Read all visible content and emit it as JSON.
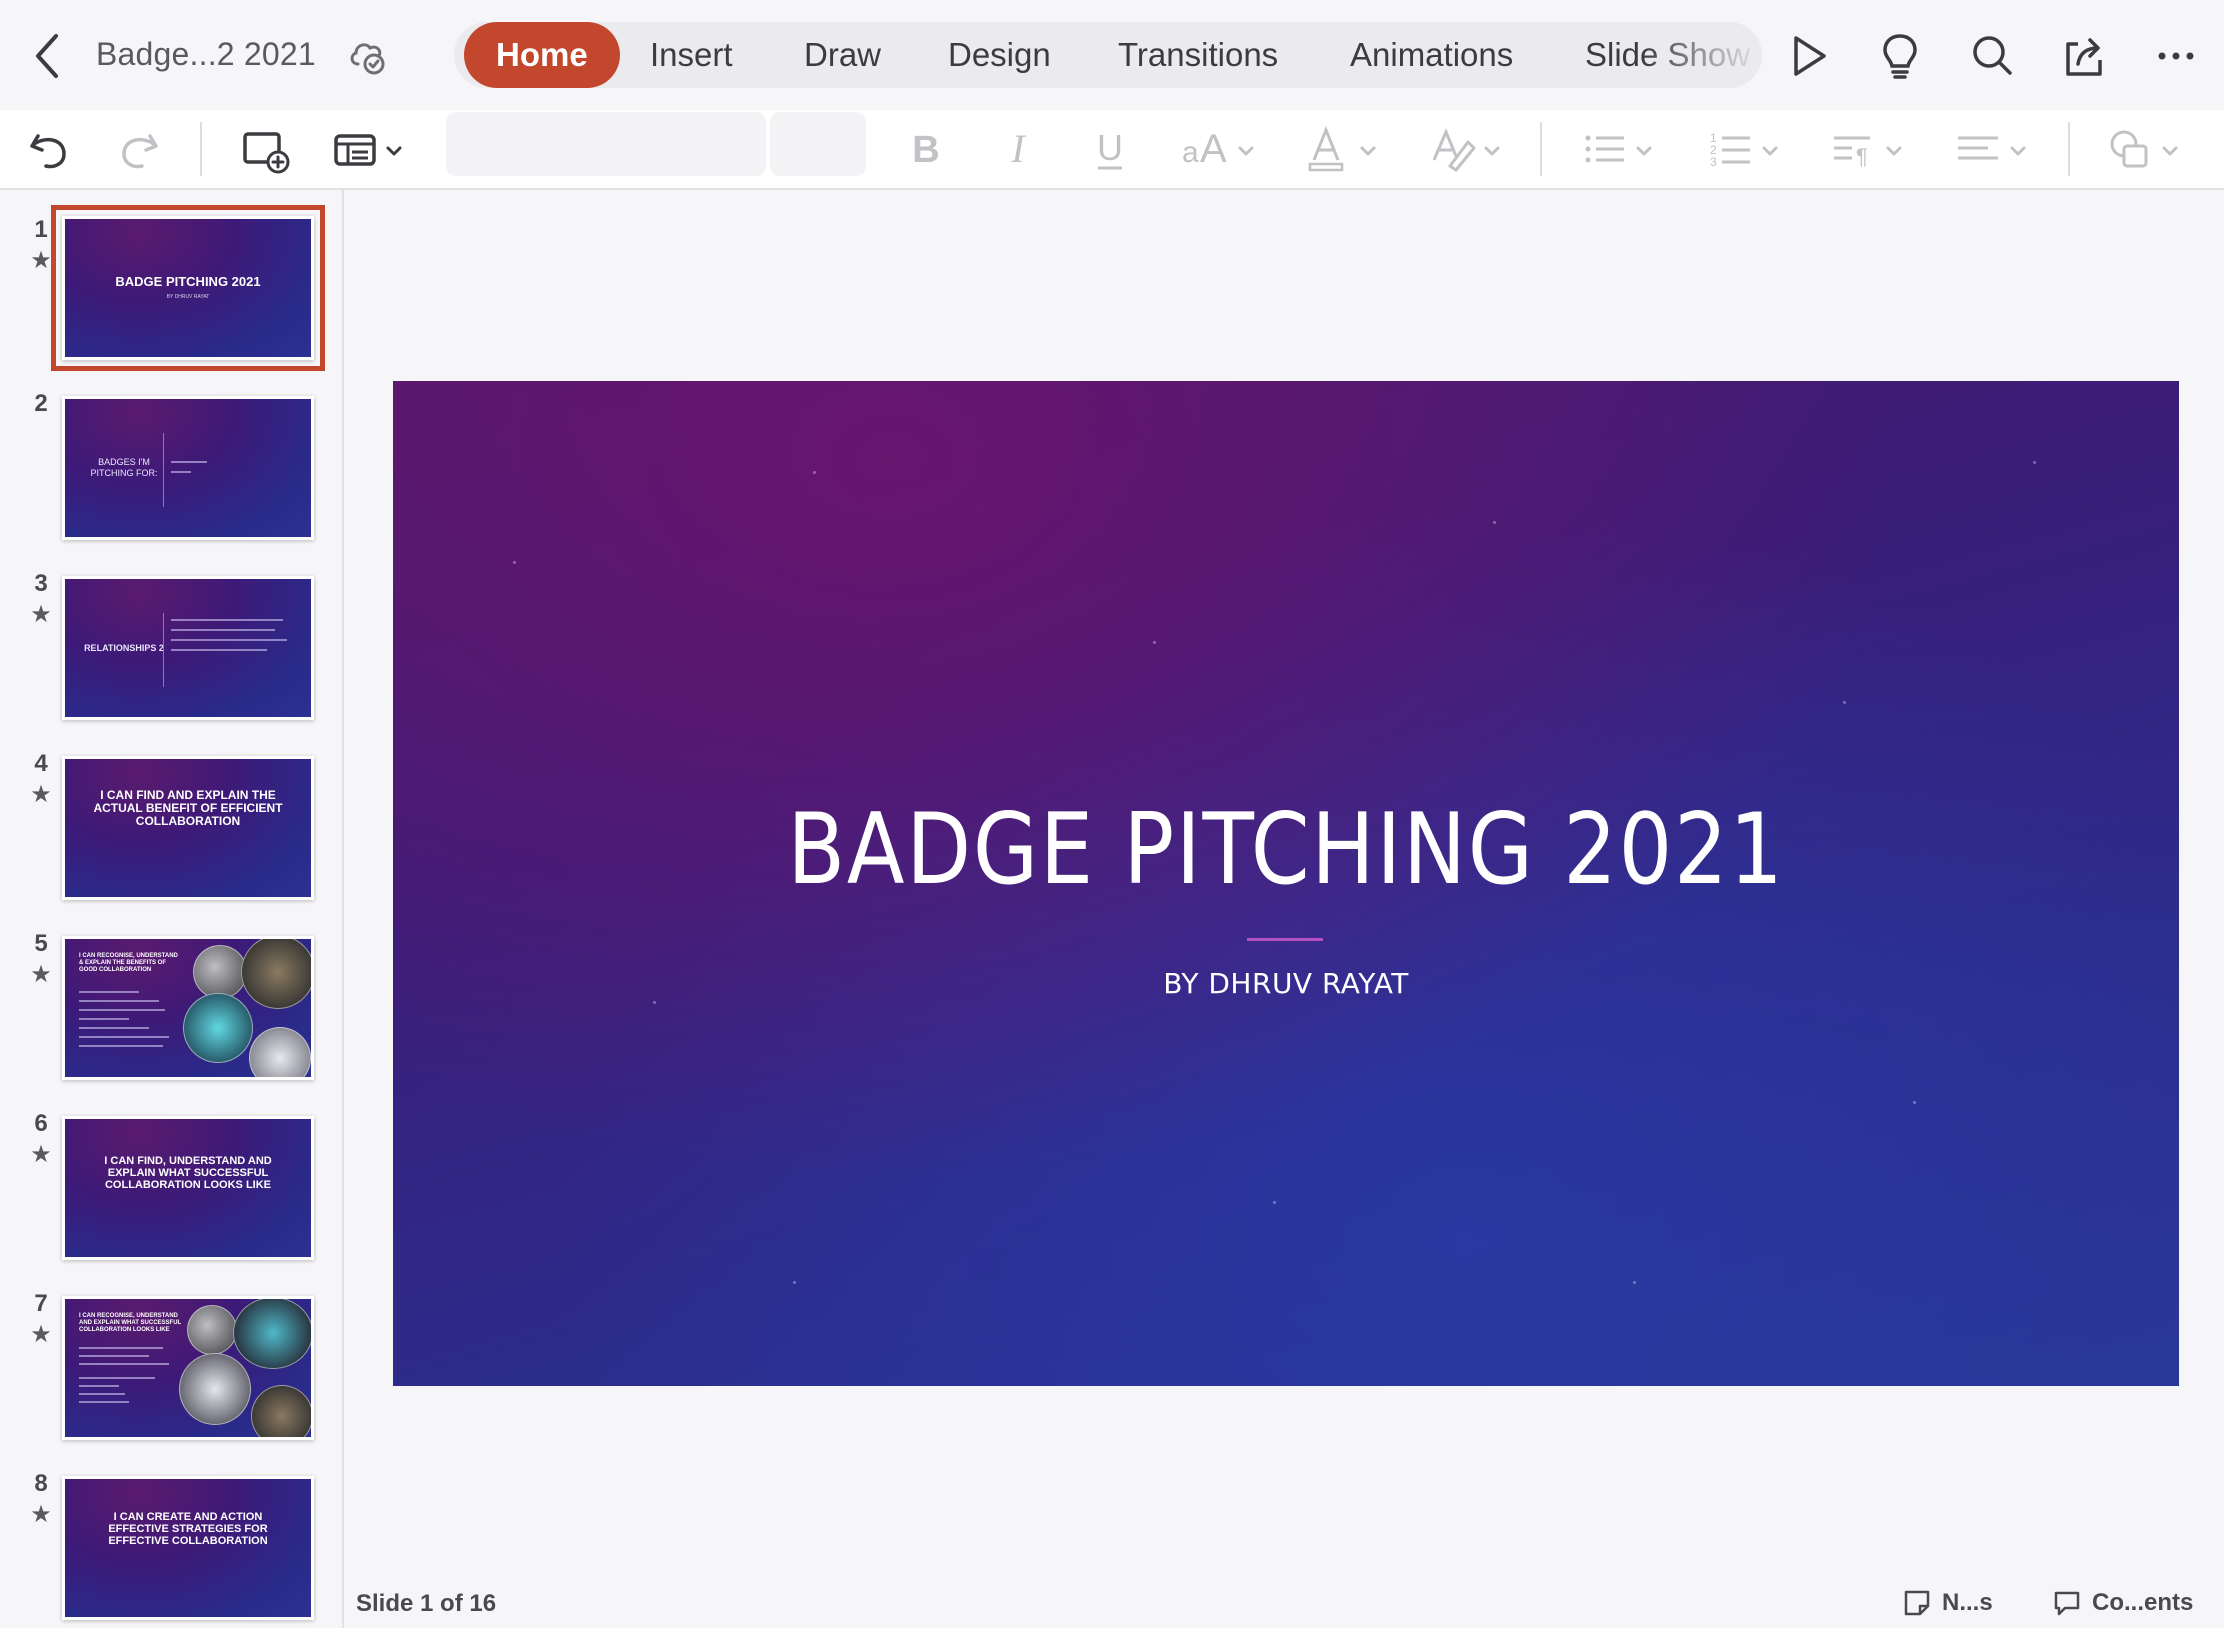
{
  "app": {
    "document_title": "Badge...2 2021"
  },
  "tabs": [
    {
      "label": "Home",
      "active": true
    },
    {
      "label": "Insert",
      "active": false
    },
    {
      "label": "Draw",
      "active": false
    },
    {
      "label": "Design",
      "active": false
    },
    {
      "label": "Transitions",
      "active": false
    },
    {
      "label": "Animations",
      "active": false
    },
    {
      "label": "Slide Show",
      "active": false
    }
  ],
  "ribbon": {
    "font_name": "",
    "font_size": ""
  },
  "thumbnails": [
    {
      "number": "1",
      "starred": true,
      "selected": true,
      "title": "BADGE PITCHING 2021",
      "subtitle": "BY DHRUV RAYAT"
    },
    {
      "number": "2",
      "starred": false,
      "left": "BADGES I'M PITCHING FOR:"
    },
    {
      "number": "3",
      "starred": true,
      "left": "RELATIONSHIPS 2"
    },
    {
      "number": "4",
      "starred": true,
      "title": "I CAN FIND AND EXPLAIN THE ACTUAL BENEFIT OF EFFICIENT COLLABORATION"
    },
    {
      "number": "5",
      "starred": true,
      "title": "I CAN RECOGNISE, UNDERSTAND & EXPLAIN THE BENEFITS OF GOOD COLLABORATION"
    },
    {
      "number": "6",
      "starred": true,
      "title": "I CAN FIND, UNDERSTAND AND EXPLAIN WHAT SUCCESSFUL COLLABORATION LOOKS LIKE"
    },
    {
      "number": "7",
      "starred": true,
      "title": "I CAN RECOGNISE, UNDERSTAND AND EXPLAIN WHAT SUCCESSFUL COLLABORATION LOOKS LIKE"
    },
    {
      "number": "8",
      "starred": true,
      "title": "I CAN CREATE AND ACTION EFFECTIVE STRATEGIES FOR EFFECTIVE COLLABORATION"
    }
  ],
  "slide": {
    "title": "BADGE PITCHING 2021",
    "subtitle": "BY DHRUV RAYAT"
  },
  "status": {
    "slide_indicator": "Slide 1 of 16",
    "notes_label": "N...s",
    "comments_label": "Co...ents"
  },
  "colors": {
    "accent": "#c3472c",
    "slide_accent_line": "#b44fc4"
  }
}
